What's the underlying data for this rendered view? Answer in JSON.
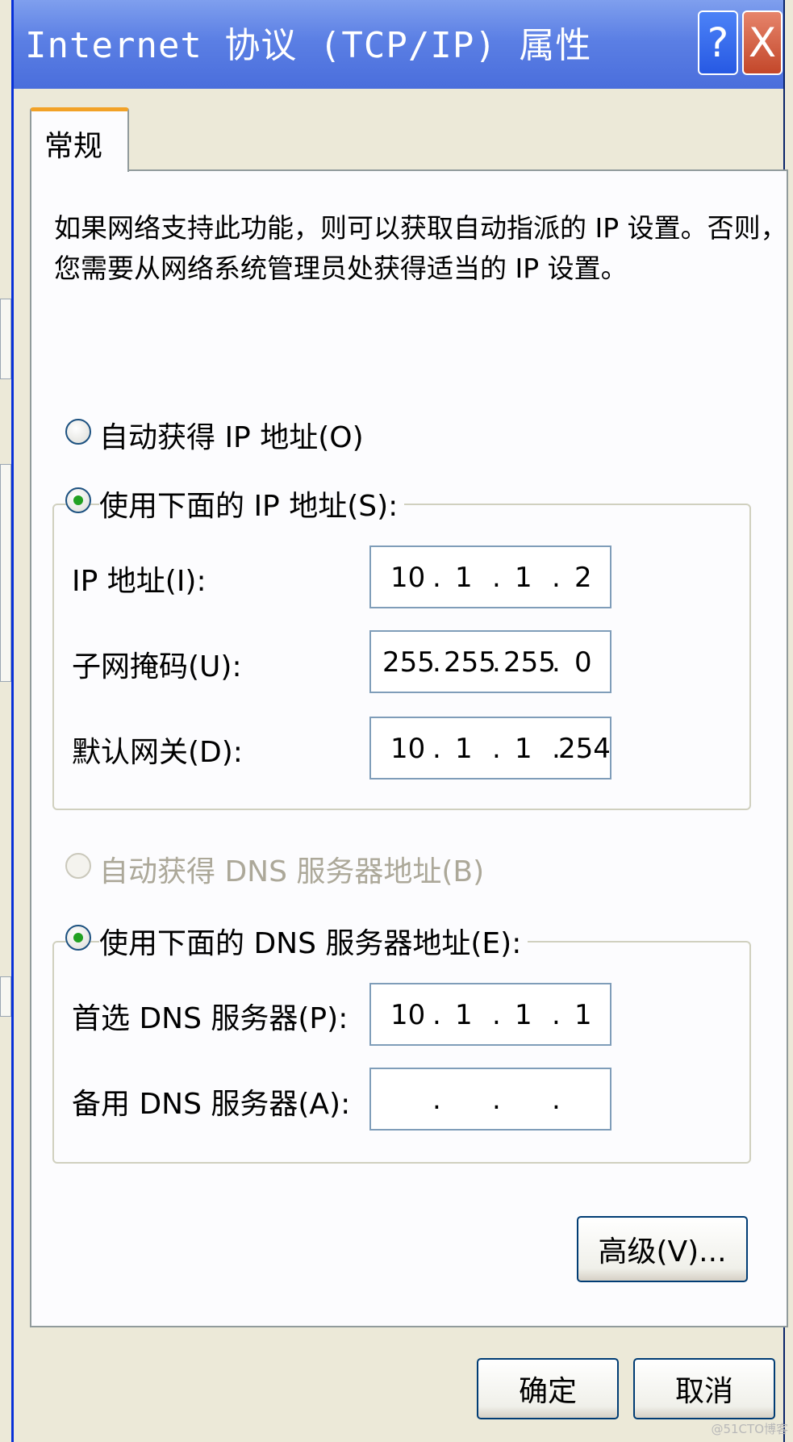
{
  "window": {
    "title": "Internet 协议 (TCP/IP) 属性",
    "help_button": "?",
    "close_button": "X"
  },
  "tabs": [
    {
      "label": "常规",
      "selected": true
    }
  ],
  "description": {
    "line1": "如果网络支持此功能，则可以获取自动指派的 IP 设置。否则，",
    "line2": "您需要从网络系统管理员处获得适当的 IP 设置。"
  },
  "ip_section": {
    "auto_option": {
      "label": "自动获得 IP 地址(O)",
      "checked": false
    },
    "manual_option": {
      "label": "使用下面的 IP 地址(S):",
      "checked": true
    },
    "fields": [
      {
        "label": "IP 地址(I):",
        "octets": [
          "10",
          "1",
          "1",
          "2"
        ]
      },
      {
        "label": "子网掩码(U):",
        "octets": [
          "255",
          "255",
          "255",
          "0"
        ]
      },
      {
        "label": "默认网关(D):",
        "octets": [
          "10",
          "1",
          "1",
          "254"
        ]
      }
    ]
  },
  "dns_section": {
    "auto_option": {
      "label": "自动获得 DNS 服务器地址(B)",
      "checked": false,
      "enabled": false
    },
    "manual_option": {
      "label": "使用下面的 DNS 服务器地址(E):",
      "checked": true
    },
    "fields": [
      {
        "label": "首选 DNS 服务器(P):",
        "octets": [
          "10",
          "1",
          "1",
          "1"
        ]
      },
      {
        "label": "备用 DNS 服务器(A):",
        "octets": [
          "",
          "",
          "",
          ""
        ]
      }
    ]
  },
  "buttons": {
    "advanced": "高级(V)...",
    "ok": "确定",
    "cancel": "取消"
  },
  "watermark": "@51CTO博客",
  "colors": {
    "titlebar": "#5b7fe4",
    "dialog_bg": "#ece9d8",
    "panel_bg": "#fcfcfe",
    "tab_accent": "#f2a227",
    "radio_dot": "#21a121",
    "field_border": "#7f9db9"
  }
}
